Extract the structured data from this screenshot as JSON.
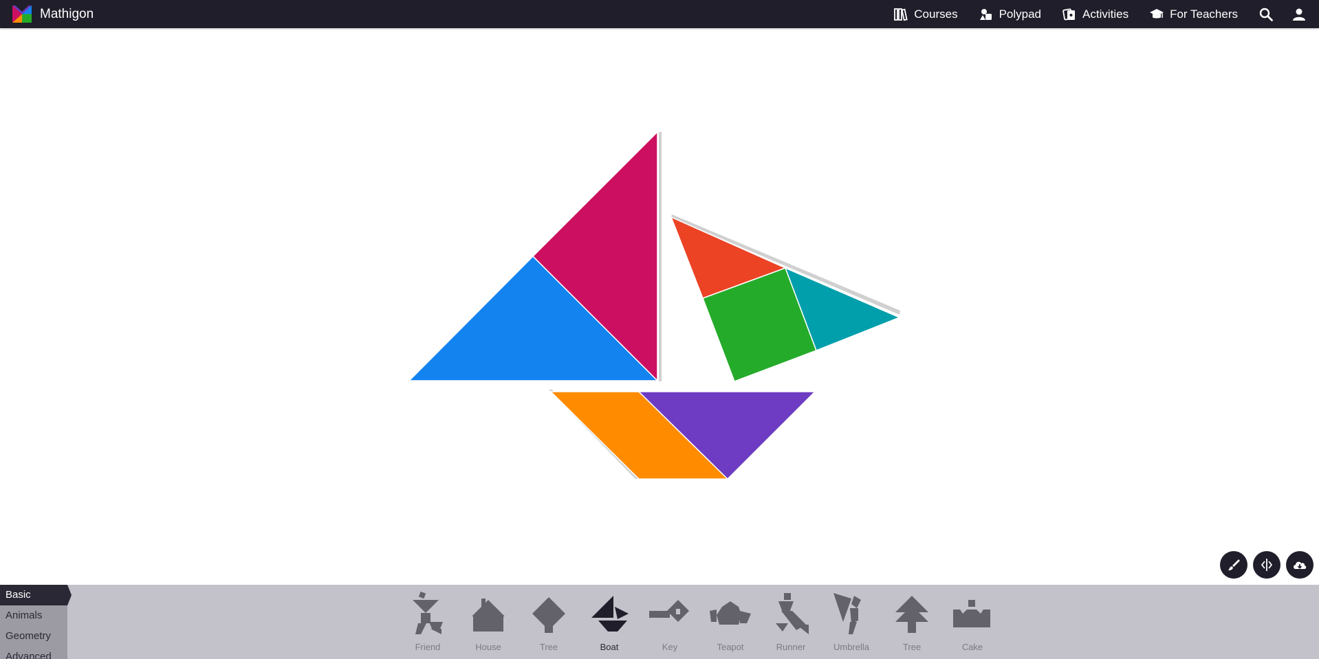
{
  "app": {
    "name": "Mathigon"
  },
  "nav": {
    "courses": "Courses",
    "polypad": "Polypad",
    "activities": "Activities",
    "for_teachers": "For Teachers"
  },
  "icons": {
    "logo": "mathigon-logo-icon",
    "courses": "books-icon",
    "polypad": "polypad-icon",
    "activities": "cards-icon",
    "teachers": "graduation-cap-icon",
    "search": "search-icon",
    "account": "user-icon",
    "draw": "brush-icon",
    "flip": "flip-icon",
    "download": "cloud-download-icon"
  },
  "colors": {
    "topbar": "#1f1e2a",
    "drawer": "#c3c1c9",
    "pieces": {
      "large_blue": "#1283ef",
      "large_magenta": "#cc0f60",
      "small_red": "#ec4325",
      "square_green": "#25ab2a",
      "small_teal": "#009fab",
      "parallelogram_orange": "#ff8c00",
      "medium_purple": "#6e3bc3"
    }
  },
  "drawer": {
    "categories": [
      {
        "label": "Basic",
        "active": true
      },
      {
        "label": "Animals",
        "active": false
      },
      {
        "label": "Geometry",
        "active": false
      },
      {
        "label": "Advanced",
        "active": false
      }
    ],
    "shapes": [
      {
        "label": "Friend",
        "selected": false
      },
      {
        "label": "House",
        "selected": false
      },
      {
        "label": "Tree",
        "selected": false
      },
      {
        "label": "Boat",
        "selected": true
      },
      {
        "label": "Key",
        "selected": false
      },
      {
        "label": "Teapot",
        "selected": false
      },
      {
        "label": "Runner",
        "selected": false
      },
      {
        "label": "Umbrella",
        "selected": false
      },
      {
        "label": "Tree",
        "selected": false
      },
      {
        "label": "Cake",
        "selected": false
      }
    ]
  }
}
